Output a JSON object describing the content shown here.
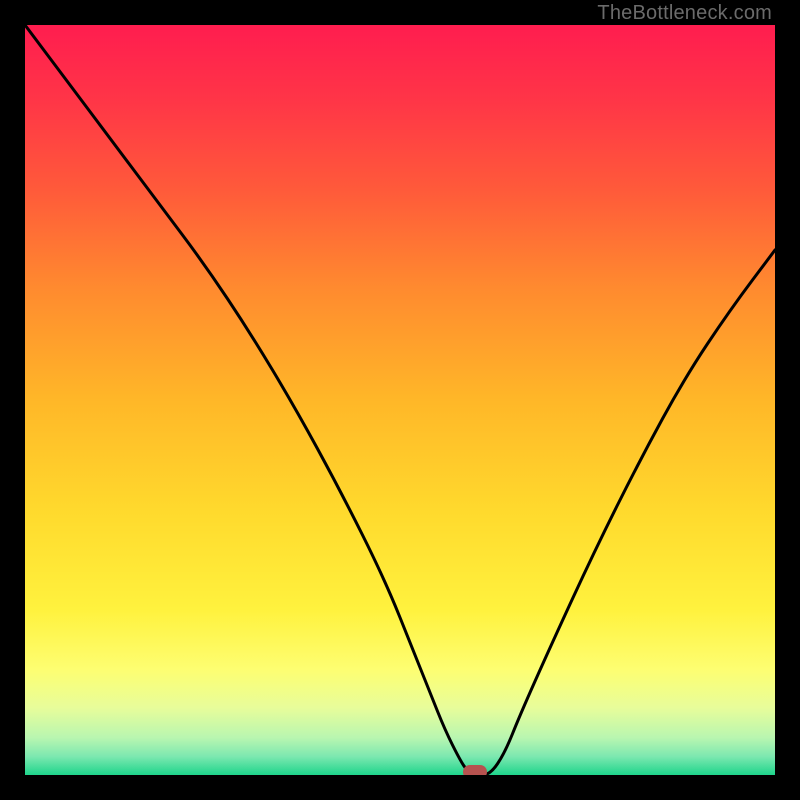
{
  "watermark": "TheBottleneck.com",
  "chart_data": {
    "type": "line",
    "title": "",
    "xlabel": "",
    "ylabel": "",
    "xlim": [
      0,
      100
    ],
    "ylim": [
      0,
      100
    ],
    "series": [
      {
        "name": "bottleneck-curve",
        "x": [
          0,
          6,
          12,
          18,
          24,
          30,
          36,
          42,
          48,
          52,
          54,
          56,
          58,
          59,
          60,
          62,
          64,
          66,
          70,
          76,
          82,
          88,
          94,
          100
        ],
        "values": [
          100,
          92,
          84,
          76,
          68,
          59,
          49,
          38,
          26,
          16,
          11,
          6,
          2,
          0.5,
          0,
          0,
          3,
          8,
          17,
          30,
          42,
          53,
          62,
          70
        ]
      }
    ],
    "annotations": [
      {
        "name": "optimum-marker",
        "x": 60,
        "y": 0
      }
    ],
    "gradient_stops": [
      {
        "offset": 0.0,
        "color": "#ff1d4f"
      },
      {
        "offset": 0.1,
        "color": "#ff3547"
      },
      {
        "offset": 0.22,
        "color": "#ff5a3a"
      },
      {
        "offset": 0.35,
        "color": "#ff8a2f"
      },
      {
        "offset": 0.5,
        "color": "#ffb728"
      },
      {
        "offset": 0.65,
        "color": "#ffda2d"
      },
      {
        "offset": 0.78,
        "color": "#fff23e"
      },
      {
        "offset": 0.86,
        "color": "#fdfe72"
      },
      {
        "offset": 0.91,
        "color": "#e8fd9a"
      },
      {
        "offset": 0.95,
        "color": "#b9f6b0"
      },
      {
        "offset": 0.975,
        "color": "#7de8b0"
      },
      {
        "offset": 1.0,
        "color": "#1fd58c"
      }
    ],
    "marker_color": "#b6524f",
    "curve_color": "#000000"
  }
}
